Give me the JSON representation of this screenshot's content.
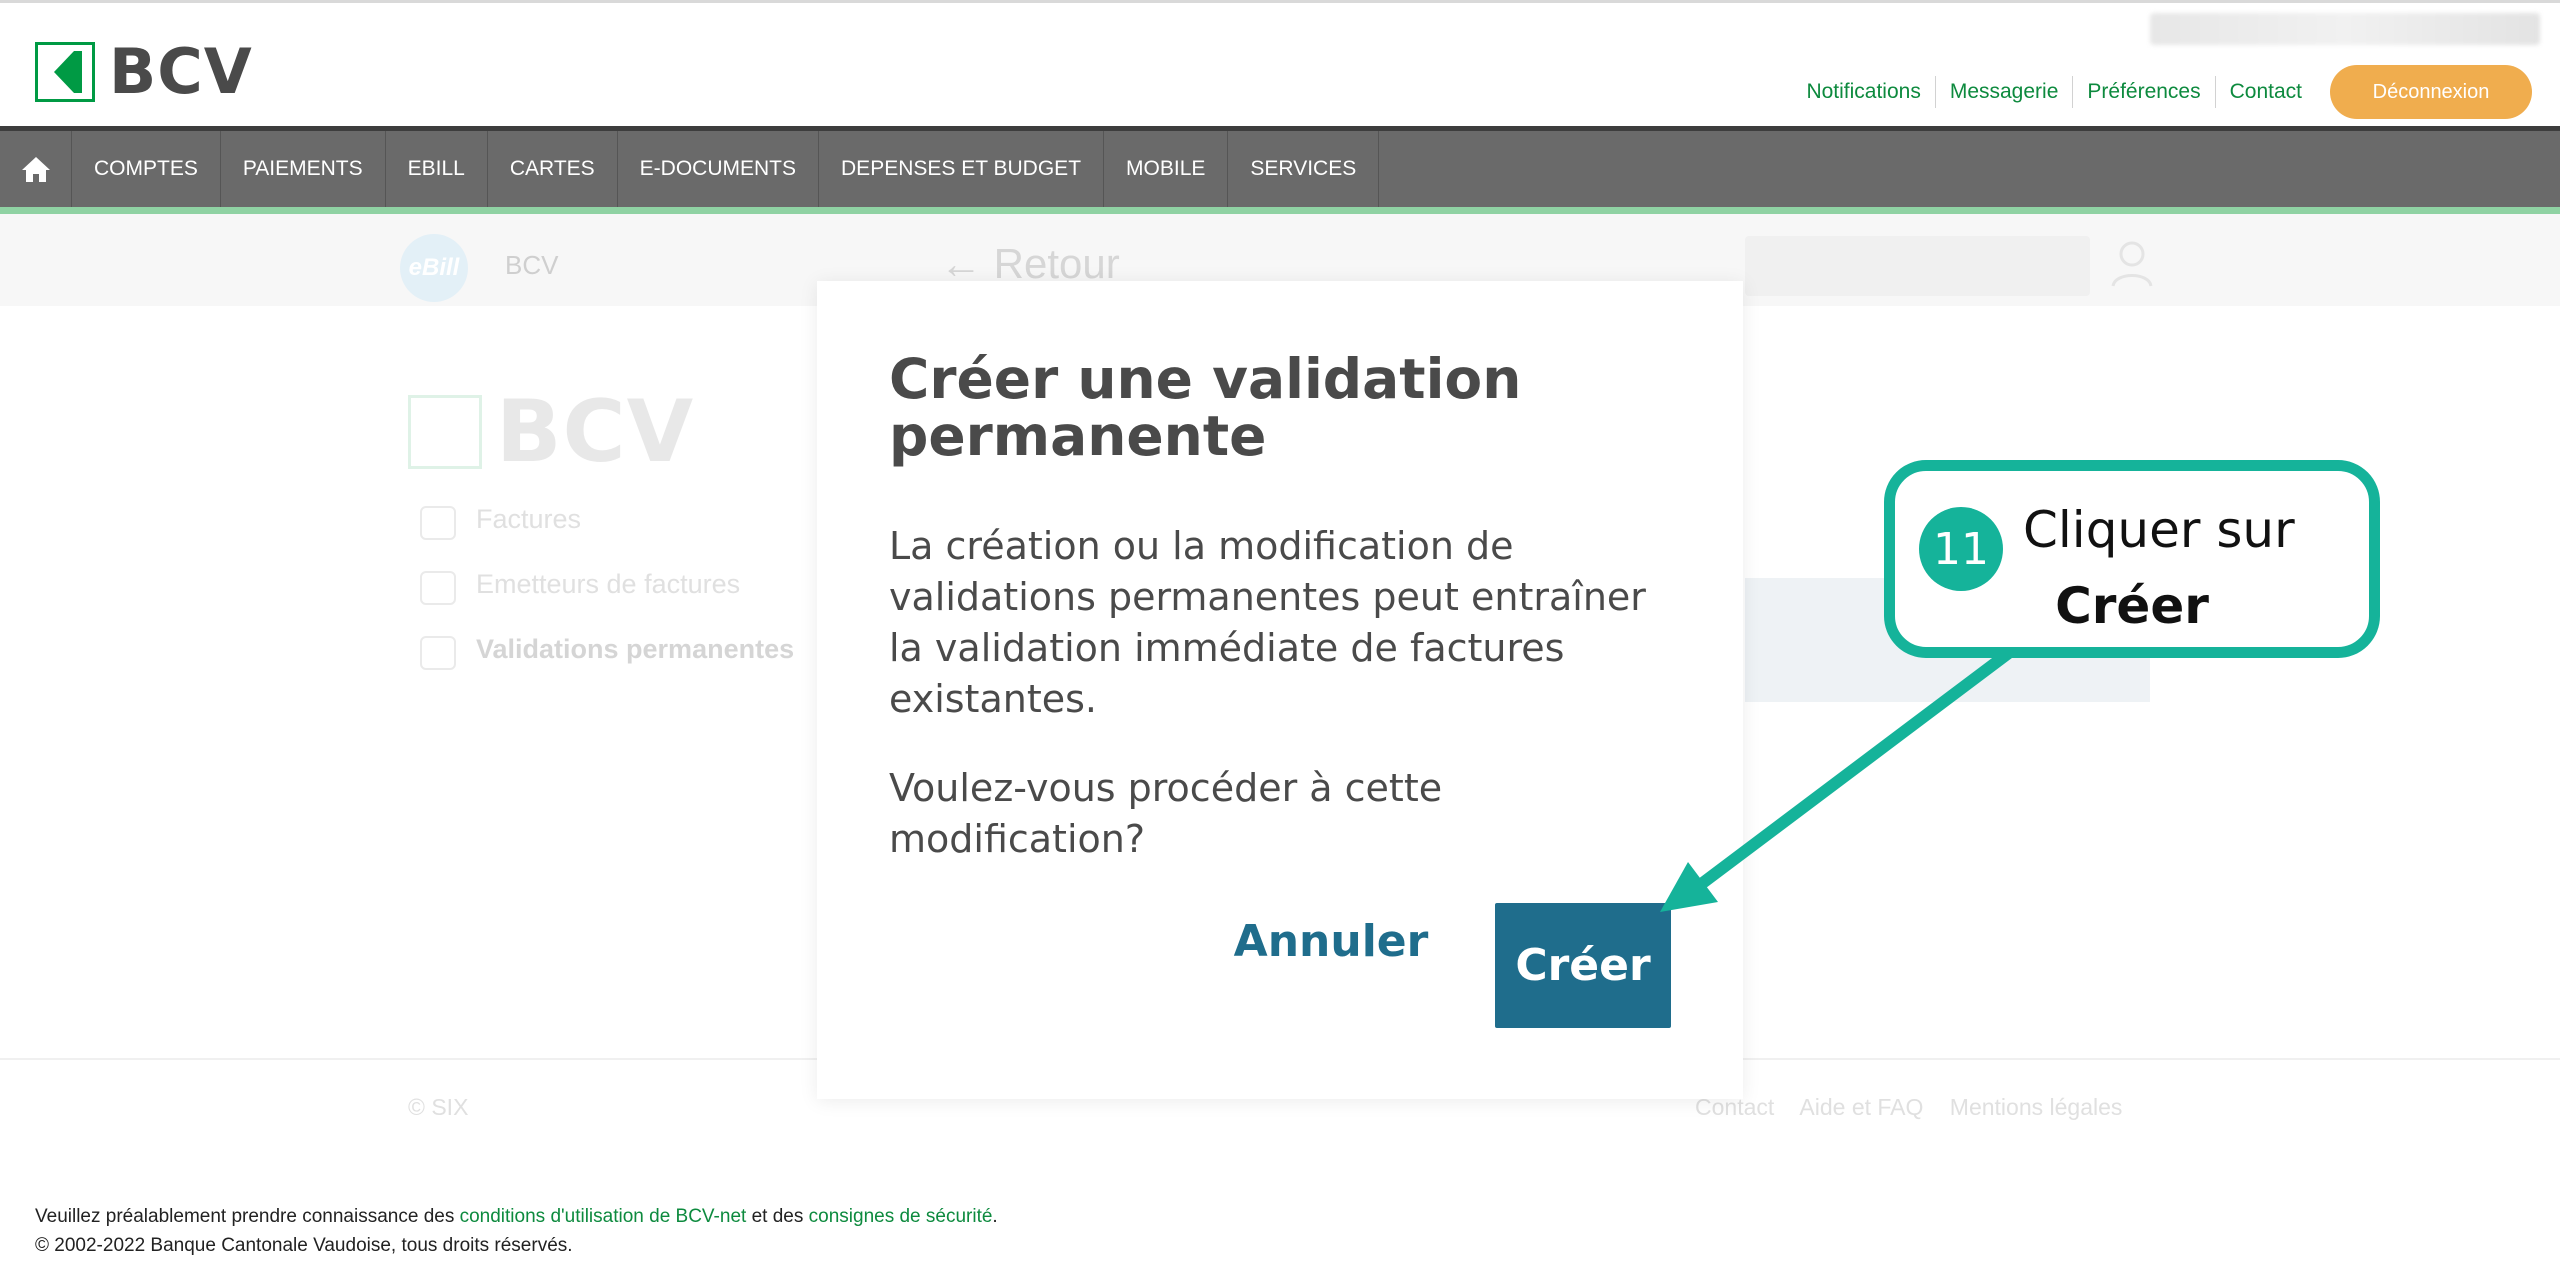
{
  "header": {
    "brand": "BCV",
    "links": [
      "Notifications",
      "Messagerie",
      "Préférences",
      "Contact"
    ],
    "logout_label": "Déconnexion"
  },
  "nav": {
    "items": [
      "COMPTES",
      "PAIEMENTS",
      "EBILL",
      "CARTES",
      "E-DOCUMENTS",
      "DEPENSES ET BUDGET",
      "MOBILE",
      "SERVICES"
    ]
  },
  "background": {
    "ebill_badge": "eBill",
    "issuer": "BCV",
    "back_label": "← Retour",
    "brand": "BCV",
    "menu": [
      "Factures",
      "Emetteurs de factures",
      "Validations permanentes"
    ],
    "footer_copyright": "© SIX",
    "footer_links": [
      "Contact",
      "Aide et FAQ",
      "Mentions légales"
    ]
  },
  "modal": {
    "title": "Créer une validation permanente",
    "body": "La création ou la modification de validations permanentes peut entraîner la validation immédiate de factures existantes.",
    "question": "Voulez-vous procéder à cette modification?",
    "cancel_label": "Annuler",
    "create_label": "Créer"
  },
  "callout": {
    "step": "11",
    "line1": "Cliquer sur",
    "line2": "Créer",
    "color": "#15b39a"
  },
  "footer": {
    "prefix": "Veuillez préalablement prendre connaissance des ",
    "link1": "conditions d'utilisation de BCV-net",
    "middle": " et des ",
    "link2": "consignes de sécurité",
    "suffix": ".",
    "copyright": "© 2002-2022 Banque Cantonale Vaudoise, tous droits réservés."
  },
  "colors": {
    "brand_green": "#009a44",
    "nav_bg": "#6a6a6a",
    "primary": "#1f6d8c",
    "logout": "#f0ad4e"
  }
}
